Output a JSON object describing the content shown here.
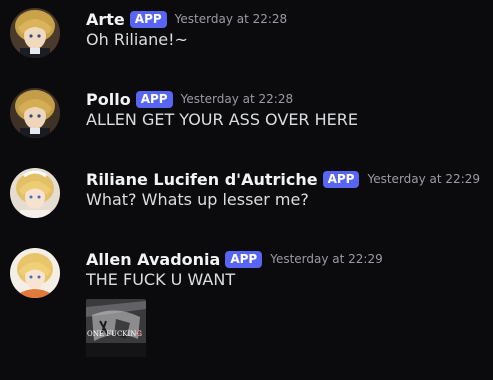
{
  "messages": [
    {
      "author": "Arte",
      "badge": "APP",
      "timestamp": "Yesterday at 22:28",
      "content": "Oh Riliane!~",
      "avatar": "anime-character-avatar"
    },
    {
      "author": "Pollo",
      "badge": "APP",
      "timestamp": "Yesterday at 22:28",
      "content": "ALLEN GET YOUR ASS OVER HERE",
      "avatar": "anime-character-avatar"
    },
    {
      "author": "Riliane Lucifen d'Autriche",
      "badge": "APP",
      "timestamp": "Yesterday at 22:29",
      "content": "What? Whats up lesser me?",
      "avatar": "anime-character-avatar"
    },
    {
      "author": "Allen Avadonia",
      "badge": "APP",
      "timestamp": "Yesterday at 22:29",
      "content": "THE FUCK U WANT",
      "avatar": "anime-character-avatar",
      "attachment": {
        "caption": "ONE FUCKING"
      }
    }
  ],
  "colors": {
    "background": "#0b0b0e",
    "author": "#f2f3f5",
    "badge": "#5865f2",
    "timestamp": "#9a9ba3",
    "content": "#dbdee1"
  }
}
